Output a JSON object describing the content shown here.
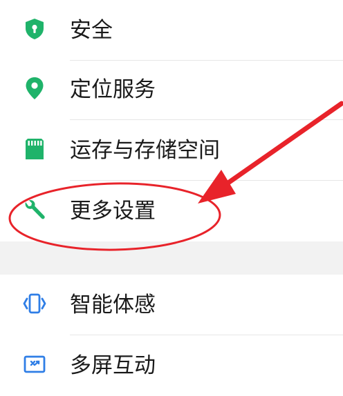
{
  "settings": {
    "items": [
      {
        "label": "安全",
        "icon": "shield-lock-icon",
        "color": "#1fb36a"
      },
      {
        "label": "定位服务",
        "icon": "location-pin-icon",
        "color": "#1fb36a"
      },
      {
        "label": "运存与存储空间",
        "icon": "sd-card-icon",
        "color": "#1fb36a"
      },
      {
        "label": "更多设置",
        "icon": "wrench-icon",
        "color": "#1fb36a"
      },
      {
        "label": "智能体感",
        "icon": "phone-vibrate-icon",
        "color": "#2f7ee6"
      },
      {
        "label": "多屏互动",
        "icon": "screen-share-icon",
        "color": "#2f7ee6"
      }
    ]
  },
  "annotation": {
    "color": "#e8232a",
    "target": "更多设置"
  }
}
